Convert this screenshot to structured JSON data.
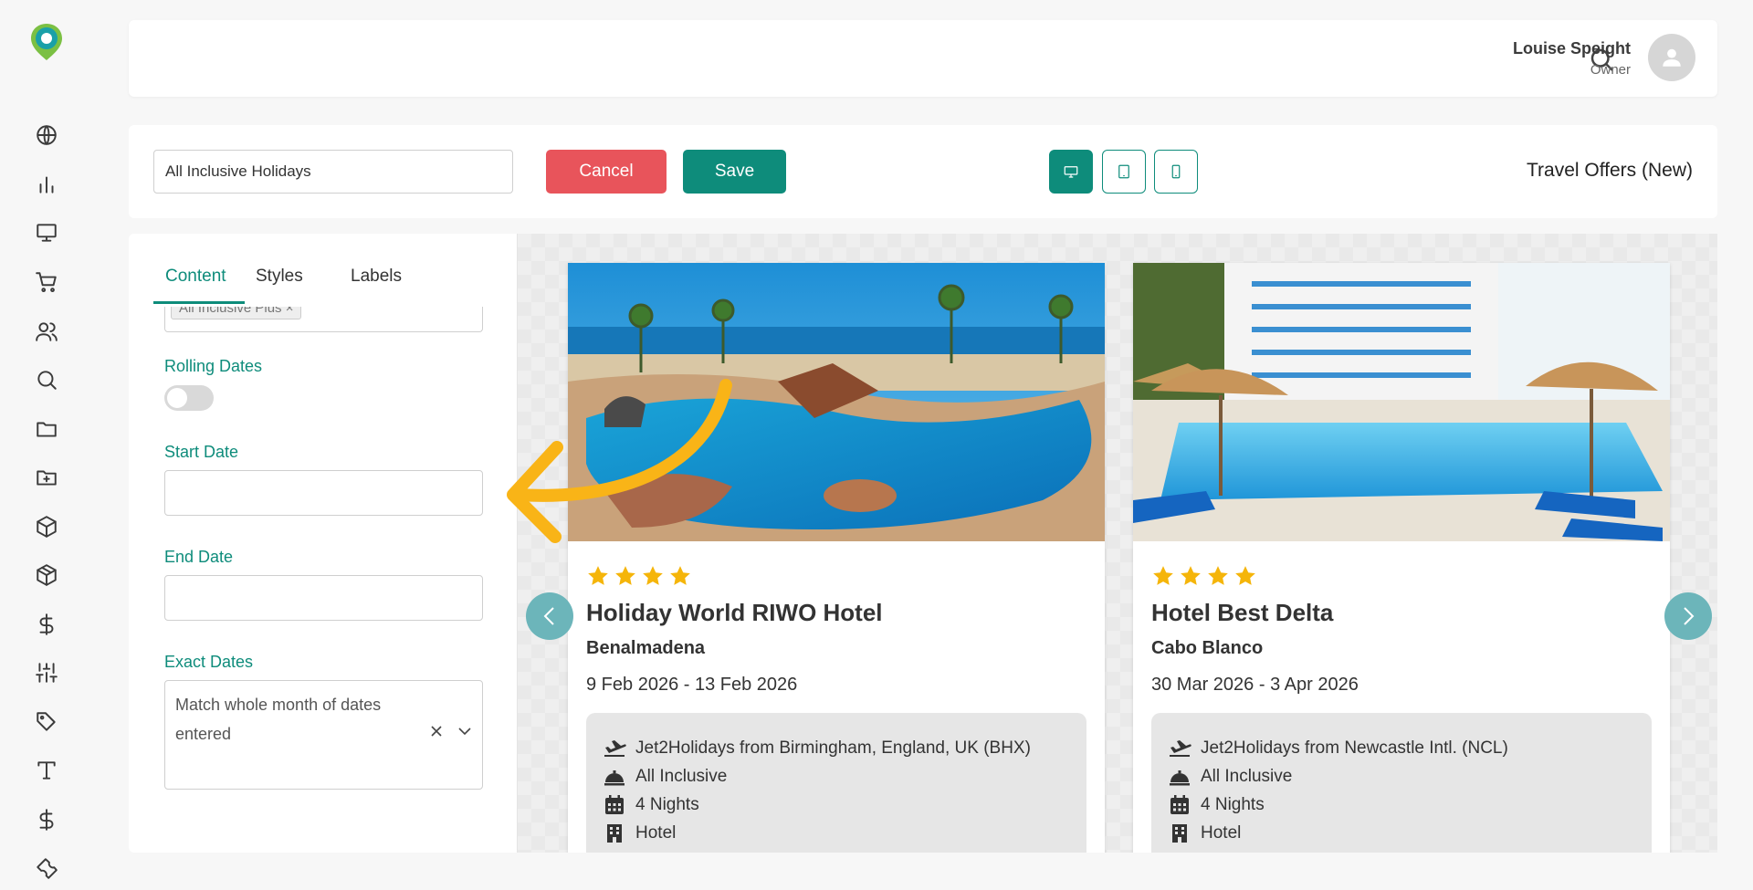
{
  "sidebar": {
    "icons": [
      "globe-icon",
      "bar-chart-icon",
      "monitor-icon",
      "cart-icon",
      "users-icon",
      "search-icon",
      "folder-icon",
      "folder-plus-icon",
      "box-icon",
      "package-icon",
      "dollar-icon",
      "sliders-icon",
      "tag-icon",
      "text-type-icon",
      "dollar-icon",
      "wrench-icon"
    ]
  },
  "header": {
    "user_name": "Louise Speight",
    "user_role": "Owner"
  },
  "toolbar": {
    "name_value": "All Inclusive Holidays",
    "cancel_label": "Cancel",
    "save_label": "Save",
    "page_title": "Travel Offers (New)",
    "device_modes": [
      "desktop",
      "tablet",
      "mobile"
    ],
    "active_device": "desktop"
  },
  "panel": {
    "tabs": [
      "Content",
      "Styles",
      "Labels"
    ],
    "active_tab": "Content",
    "chip_label": "All Inclusive Plus",
    "rolling_dates_label": "Rolling Dates",
    "rolling_dates_on": false,
    "start_date_label": "Start Date",
    "start_date_value": "",
    "end_date_label": "End Date",
    "end_date_value": "",
    "exact_dates_label": "Exact Dates",
    "exact_dates_value": "Match whole month of dates entered"
  },
  "cards": [
    {
      "stars": 4,
      "name": "Holiday World RIWO Hotel",
      "resort": "Benalmadena",
      "dates": "9 Feb 2026 - 13 Feb 2026",
      "details": {
        "flight": "Jet2Holidays from Birmingham, England, UK (BHX)",
        "board": "All Inclusive",
        "nights": "4 Nights",
        "type": "Hotel"
      }
    },
    {
      "stars": 4,
      "name": "Hotel Best Delta",
      "resort": "Cabo Blanco",
      "dates": "30 Mar 2026 - 3 Apr 2026",
      "details": {
        "flight": "Jet2Holidays from Newcastle Intl. (NCL)",
        "board": "All Inclusive",
        "nights": "4 Nights",
        "type": "Hotel"
      }
    }
  ],
  "colors": {
    "accent": "#0e8c7b",
    "cancel": "#e8545b",
    "star": "#f5b50a",
    "annotation_arrow": "#f9b417",
    "carousel_arrow": "#6cb5ba"
  }
}
